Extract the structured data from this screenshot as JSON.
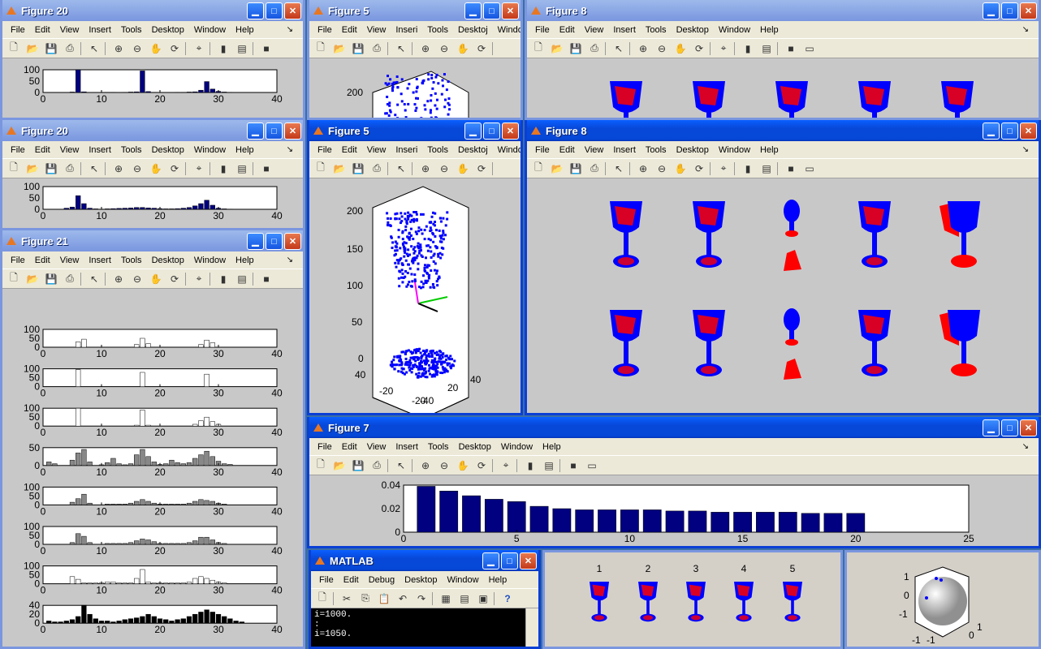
{
  "menus": {
    "figure": [
      "File",
      "Edit",
      "View",
      "Insert",
      "Tools",
      "Desktop",
      "Window",
      "Help"
    ],
    "figure_narrow": [
      "File",
      "Edit",
      "View",
      "Inseri",
      "Tools",
      "Desktoj",
      "Windov",
      "Help"
    ],
    "matlab": [
      "File",
      "Edit",
      "Debug",
      "Desktop",
      "Window",
      "Help"
    ]
  },
  "windows": {
    "fig20a": {
      "title": "Figure 20"
    },
    "fig20b": {
      "title": "Figure 20"
    },
    "fig21": {
      "title": "Figure 21"
    },
    "fig5a": {
      "title": "Figure 5"
    },
    "fig5b": {
      "title": "Figure 5"
    },
    "fig8a": {
      "title": "Figure 8"
    },
    "fig8b": {
      "title": "Figure 8"
    },
    "fig7": {
      "title": "Figure 7"
    },
    "matlab": {
      "title": "MATLAB",
      "cmd_lines": [
        "i=1000.",
        ":",
        "i=1050."
      ]
    }
  },
  "colors": {
    "titlebar": "#0a48d8",
    "bar_navy": "#000080",
    "blue_points": "#0000ff",
    "red_points": "#ff0000",
    "plot_bg": "#ffffff",
    "fig_bg": "#c8c8c8"
  },
  "chart_data": [
    {
      "id": "fig7",
      "type": "bar",
      "x": [
        1,
        2,
        3,
        4,
        5,
        6,
        7,
        8,
        9,
        10,
        11,
        12,
        13,
        14,
        15,
        16,
        17,
        18,
        19,
        20
      ],
      "values": [
        0.039,
        0.035,
        0.031,
        0.028,
        0.026,
        0.022,
        0.02,
        0.019,
        0.019,
        0.019,
        0.019,
        0.018,
        0.018,
        0.017,
        0.017,
        0.017,
        0.017,
        0.016,
        0.016,
        0.016
      ],
      "xlim": [
        0,
        25
      ],
      "ylim": [
        0,
        0.04
      ],
      "xticks": [
        "0",
        "5",
        "10",
        "15",
        "20",
        "25"
      ],
      "yticks": [
        "0",
        "0.02",
        "0.04"
      ],
      "color": "#000080"
    },
    {
      "id": "fig20a",
      "type": "bar",
      "xlim": [
        0,
        40
      ],
      "ylim": [
        0,
        100
      ],
      "xticks": [
        "0",
        "10",
        "20",
        "30",
        "40"
      ],
      "yticks": [
        "0",
        "50",
        "100"
      ],
      "values": [
        0,
        0,
        0,
        0,
        2,
        100,
        3,
        0,
        0,
        0,
        1,
        1,
        0,
        1,
        2,
        3,
        95,
        4,
        1,
        0,
        0,
        0,
        1,
        1,
        2,
        3,
        10,
        48,
        15,
        5,
        2,
        1,
        0,
        0,
        0,
        0,
        0,
        0,
        0,
        0
      ],
      "color": "#000080"
    },
    {
      "id": "fig20b",
      "type": "bar",
      "xlim": [
        0,
        40
      ],
      "ylim": [
        0,
        100
      ],
      "xticks": [
        "0",
        "10",
        "20",
        "30",
        "40"
      ],
      "yticks": [
        "0",
        "50",
        "100"
      ],
      "values": [
        0,
        0,
        0,
        5,
        10,
        60,
        25,
        5,
        2,
        1,
        2,
        3,
        4,
        5,
        6,
        8,
        8,
        6,
        5,
        3,
        2,
        2,
        3,
        5,
        8,
        15,
        25,
        40,
        18,
        5,
        2,
        1,
        0,
        0,
        0,
        0,
        0,
        0,
        0,
        0
      ],
      "color": "#000080"
    },
    {
      "id": "fig21",
      "type": "bar",
      "xlim": [
        0,
        40
      ],
      "xticks": [
        "0",
        "10",
        "20",
        "30",
        "40"
      ],
      "subplots": [
        {
          "yticks": [
            "0",
            "50",
            "100"
          ],
          "ymax": 100,
          "color": "#ffffff",
          "values": [
            0,
            0,
            0,
            0,
            0,
            30,
            45,
            0,
            0,
            0,
            0,
            0,
            0,
            0,
            0,
            15,
            50,
            20,
            0,
            0,
            0,
            0,
            0,
            0,
            0,
            0,
            15,
            40,
            25,
            0,
            0,
            0,
            0,
            0,
            0,
            0,
            0,
            0,
            0,
            0
          ]
        },
        {
          "yticks": [
            "0",
            "50",
            "100"
          ],
          "ymax": 100,
          "color": "#ffffff",
          "values": [
            0,
            0,
            0,
            0,
            0,
            95,
            0,
            0,
            0,
            0,
            0,
            0,
            0,
            0,
            0,
            0,
            80,
            0,
            0,
            0,
            0,
            0,
            0,
            0,
            0,
            0,
            0,
            70,
            0,
            0,
            0,
            0,
            0,
            0,
            0,
            0,
            0,
            0,
            0,
            0
          ]
        },
        {
          "yticks": [
            "0",
            "50",
            "100"
          ],
          "ymax": 100,
          "color": "#ffffff",
          "values": [
            0,
            0,
            0,
            0,
            0,
            100,
            0,
            0,
            0,
            0,
            0,
            0,
            0,
            0,
            0,
            5,
            90,
            5,
            0,
            0,
            0,
            0,
            0,
            0,
            0,
            10,
            30,
            50,
            25,
            10,
            0,
            0,
            0,
            0,
            0,
            0,
            0,
            0,
            0,
            0
          ]
        },
        {
          "yticks": [
            "0",
            "50"
          ],
          "ymax": 50,
          "color": "#888888",
          "values": [
            10,
            5,
            0,
            0,
            15,
            35,
            45,
            10,
            0,
            2,
            8,
            20,
            5,
            2,
            5,
            30,
            45,
            25,
            10,
            3,
            5,
            15,
            8,
            5,
            8,
            20,
            30,
            40,
            25,
            12,
            5,
            3,
            0,
            0,
            0,
            0,
            0,
            0,
            0,
            0
          ]
        },
        {
          "yticks": [
            "0",
            "50",
            "100"
          ],
          "ymax": 100,
          "color": "#888888",
          "values": [
            0,
            0,
            0,
            0,
            15,
            35,
            60,
            10,
            0,
            0,
            5,
            5,
            5,
            5,
            10,
            20,
            30,
            20,
            10,
            5,
            5,
            5,
            5,
            5,
            10,
            20,
            30,
            25,
            20,
            10,
            5,
            0,
            0,
            0,
            0,
            0,
            0,
            0,
            0,
            0
          ]
        },
        {
          "yticks": [
            "0",
            "50",
            "100"
          ],
          "ymax": 100,
          "color": "#888888",
          "values": [
            0,
            0,
            0,
            0,
            10,
            60,
            45,
            10,
            0,
            0,
            5,
            5,
            5,
            5,
            10,
            20,
            30,
            25,
            15,
            5,
            5,
            5,
            5,
            5,
            10,
            20,
            40,
            40,
            25,
            10,
            5,
            0,
            0,
            0,
            0,
            0,
            0,
            0,
            0,
            0
          ]
        },
        {
          "yticks": [
            "0",
            "50",
            "100"
          ],
          "ymax": 100,
          "color": "#ffffff",
          "values": [
            0,
            0,
            0,
            0,
            40,
            25,
            5,
            5,
            5,
            5,
            10,
            10,
            5,
            5,
            5,
            30,
            80,
            10,
            5,
            5,
            5,
            5,
            5,
            5,
            10,
            30,
            40,
            30,
            20,
            10,
            5,
            0,
            0,
            0,
            0,
            0,
            0,
            0,
            0,
            0
          ]
        },
        {
          "yticks": [
            "0",
            "20",
            "40"
          ],
          "ymax": 40,
          "color": "#000000",
          "values": [
            5,
            3,
            3,
            5,
            8,
            15,
            40,
            20,
            10,
            5,
            5,
            3,
            5,
            8,
            10,
            12,
            15,
            20,
            15,
            10,
            8,
            5,
            8,
            10,
            15,
            20,
            25,
            30,
            25,
            20,
            15,
            10,
            5,
            3,
            0,
            0,
            0,
            0,
            0,
            0
          ]
        }
      ]
    },
    {
      "id": "fig5",
      "type": "scatter",
      "zticks": [
        "0",
        "50",
        "100",
        "150",
        "200"
      ],
      "xticks": [
        "-40",
        "-20",
        "40"
      ],
      "yticks": [
        "-20",
        "40",
        "20"
      ]
    },
    {
      "id": "glass-labels",
      "type": "scatter",
      "labels": [
        "1",
        "2",
        "3",
        "4",
        "5"
      ]
    },
    {
      "id": "sphere",
      "type": "scatter",
      "ticks": [
        "1",
        "0",
        "-1",
        "-1",
        "-1",
        "0",
        "1"
      ]
    }
  ]
}
